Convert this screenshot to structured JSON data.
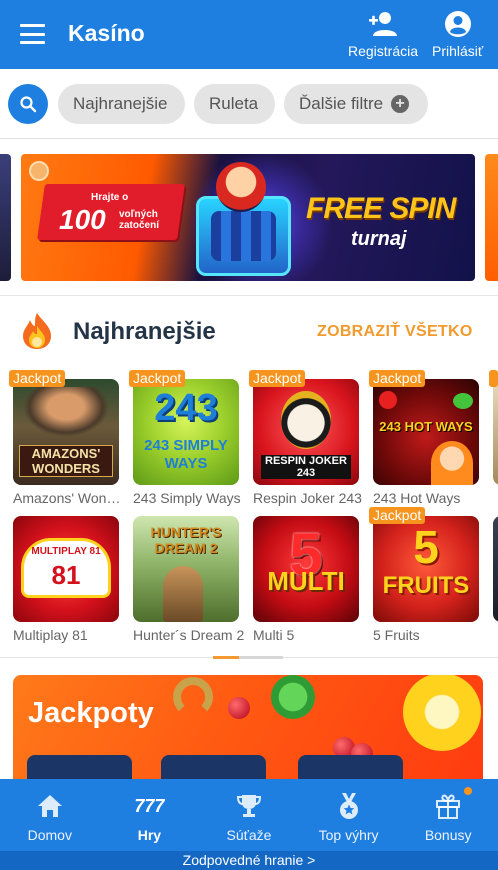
{
  "header": {
    "title": "Kasíno",
    "register_label": "Registrácia",
    "login_label": "Prihlásiť",
    "menu_icon": "hamburger-menu-icon",
    "register_icon": "add-user-icon",
    "login_icon": "account-circle-icon"
  },
  "filters": {
    "chips": [
      "Najhranejšie",
      "Ruleta",
      "Ďalšie filtre"
    ],
    "more_icon": "plus-circle-icon"
  },
  "promo": {
    "line1": "Hrajte o",
    "number": "100",
    "unit": "voľných zatočení",
    "title": "FREE SPIN",
    "subtitle": "turnaj",
    "logo": "FREE SPIN"
  },
  "section": {
    "title": "Najhranejšie",
    "see_all": "ZOBRAZIŤ VŠETKO"
  },
  "games_row1": [
    {
      "name": "Amazons' Wonders",
      "jackpot": "Jackpot",
      "art": "AMAZONS' WONDERS"
    },
    {
      "name": "243 Simply Ways",
      "jackpot": "Jackpot",
      "art": "243 SIMPLY WAYS"
    },
    {
      "name": "Respin Joker 243",
      "jackpot": "Jackpot",
      "art": "RESPIN JOKER 243"
    },
    {
      "name": "243 Hot Ways",
      "jackpot": "Jackpot",
      "art": "243 HOT WAYS"
    }
  ],
  "games_row2": [
    {
      "name": "Multiplay 81",
      "art": "MULTIPLAY 81"
    },
    {
      "name": "Hunter´s Dream 2",
      "art": "HUNTER'S DREAM 2"
    },
    {
      "name": "Multi 5",
      "art": "5 MULTI"
    },
    {
      "name": "5 Fruits",
      "jackpot": "Jackpot",
      "art": "5 FRUITS"
    }
  ],
  "jackpot_banner": {
    "title": "Jackpoty"
  },
  "bottom_nav": [
    {
      "label": "Domov",
      "icon": "home-icon"
    },
    {
      "label": "Hry",
      "icon": "777-icon",
      "glyph": "777",
      "active": true
    },
    {
      "label": "Súťaže",
      "icon": "trophy-icon"
    },
    {
      "label": "Top výhry",
      "icon": "medal-icon"
    },
    {
      "label": "Bonusy",
      "icon": "gift-icon"
    }
  ],
  "footer": {
    "responsible_link": "Zodpovedné hranie >"
  },
  "colors": {
    "primary_blue": "#1f7fe0",
    "accent_orange": "#f29a2e",
    "jackpot_badge": "#f6941e"
  }
}
